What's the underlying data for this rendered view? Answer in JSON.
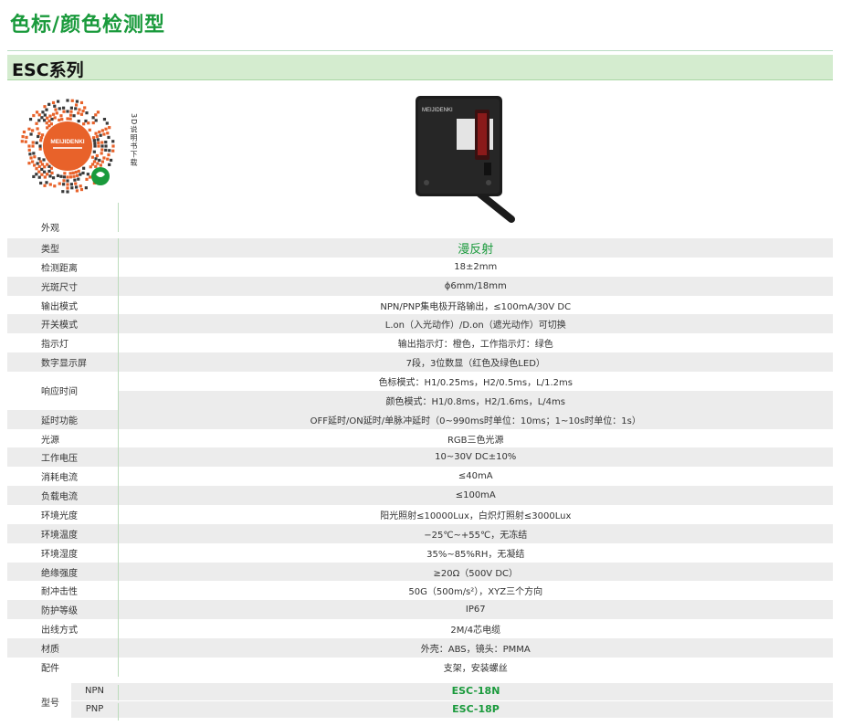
{
  "page": {
    "title": "色标/颜色检测型",
    "series": "ESC系列"
  },
  "qr": {
    "caption": "3D说明书下载",
    "brand": "MEIJIDENKI",
    "colors": {
      "ring": "#e8622a",
      "accent": "#1a9a3c"
    }
  },
  "product": {
    "brand": "MEIJIDENKI"
  },
  "appearance_label": "外观",
  "specs": [
    {
      "label": "类型",
      "value": "漫反射",
      "style": "hl"
    },
    {
      "label": "检测距离",
      "value": "18±2mm"
    },
    {
      "label": "光斑尺寸",
      "value": "ϕ6mm/18mm"
    },
    {
      "label": "输出模式",
      "value": "NPN/PNP集电极开路输出，≤100mA/30V DC"
    },
    {
      "label": "开关模式",
      "value": "L.on（入光动作）/D.on（遮光动作）可切换"
    },
    {
      "label": "指示灯",
      "value": "输出指示灯：橙色，工作指示灯：绿色"
    },
    {
      "label": "数字显示屏",
      "value": "7段，3位数显（红色及绿色LED）"
    }
  ],
  "response": {
    "label": "响应时间",
    "values": [
      "色标模式：H1/0.25ms，H2/0.5ms，L/1.2ms",
      "颜色模式：H1/0.8ms，H2/1.6ms，L/4ms"
    ]
  },
  "specs2": [
    {
      "label": "延时功能",
      "value": "OFF延时/ON延时/单脉冲延时（0~990ms时单位：10ms；1~10s时单位：1s）"
    },
    {
      "label": "光源",
      "value": "RGB三色光源"
    },
    {
      "label": "工作电压",
      "value": "10~30V DC±10%"
    },
    {
      "label": "消耗电流",
      "value": "≤40mA"
    },
    {
      "label": "负载电流",
      "value": "≤100mA"
    },
    {
      "label": "环境光度",
      "value": "阳光照射≤10000Lux，白炽灯照射≤3000Lux"
    },
    {
      "label": "环境温度",
      "value": "−25℃~+55℃，无冻结"
    },
    {
      "label": "环境湿度",
      "value": "35%~85%RH，无凝结"
    },
    {
      "label": "绝缘强度",
      "value": "≥20Ω（500V DC）"
    },
    {
      "label": "耐冲击性",
      "value": "50G（500m/s²），XYZ三个方向"
    },
    {
      "label": "防护等级",
      "value": "IP67"
    },
    {
      "label": "出线方式",
      "value": "2M/4芯电缆"
    },
    {
      "label": "材质",
      "value": "外壳：ABS，镜头：PMMA"
    },
    {
      "label": "配件",
      "value": "支架，安装螺丝"
    }
  ],
  "model": {
    "label": "型号",
    "rows": [
      {
        "code": "NPN",
        "value": "ESC-18N"
      },
      {
        "code": "PNP",
        "value": "ESC-18P"
      }
    ]
  }
}
